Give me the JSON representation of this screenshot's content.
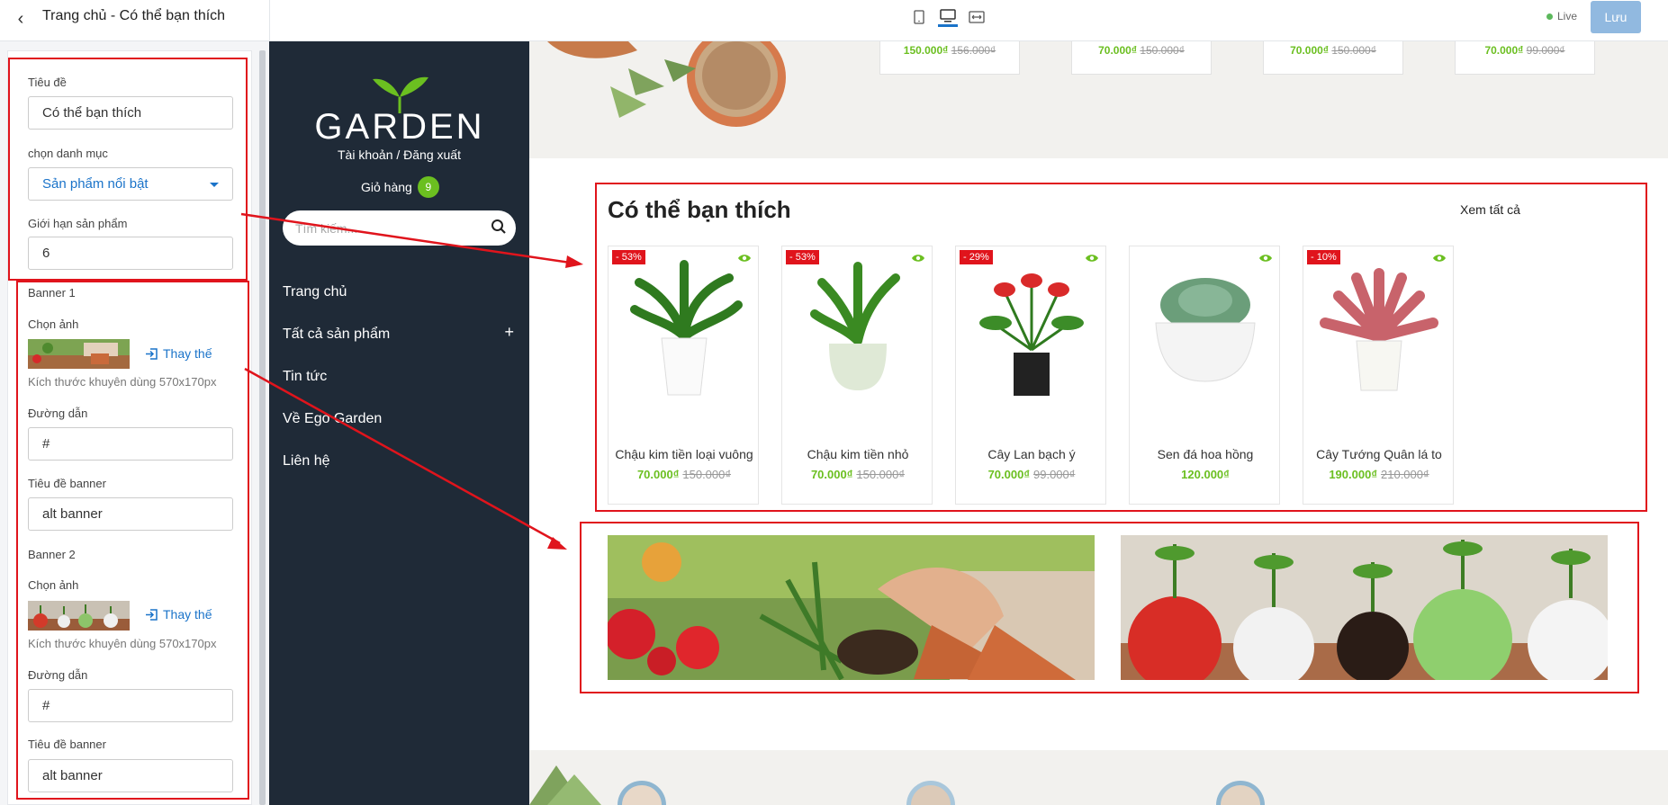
{
  "topbar": {
    "title": "Trang chủ - Có thể bạn thích",
    "live": "Live",
    "save": "Lưu"
  },
  "sidebar": {
    "title_label": "Tiêu đề",
    "title_value": "Có thể bạn thích",
    "category_label": "chọn danh mục",
    "category_value": "Sản phẩm nổi bật",
    "limit_label": "Giới hạn sản phẩm",
    "limit_value": "6",
    "banners": [
      {
        "heading": "Banner 1",
        "image_label": "Chọn ảnh",
        "replace": "Thay thế",
        "hint": "Kích thước khuyên dùng 570x170px",
        "link_label": "Đường dẫn",
        "link_value": "#",
        "alt_label": "Tiêu đề banner",
        "alt_value": "alt banner"
      },
      {
        "heading": "Banner 2",
        "image_label": "Chọn ảnh",
        "replace": "Thay thế",
        "hint": "Kích thước khuyên dùng 570x170px",
        "link_label": "Đường dẫn",
        "link_value": "#",
        "alt_label": "Tiêu đề banner",
        "alt_value": "alt banner"
      }
    ]
  },
  "store": {
    "logo": "GARDEN",
    "account": "Tài khoản / Đăng xuất",
    "cart_label": "Giỏ hàng",
    "cart_count": "9",
    "search_placeholder": "Tìm kiếm...",
    "menu": [
      "Trang chủ",
      "Tất cả sản phẩm",
      "Tin tức",
      "Về Ego Garden",
      "Liên hệ"
    ]
  },
  "previous_prices": [
    {
      "new": "150.000₫",
      "old": "156.000₫"
    },
    {
      "new": "70.000₫",
      "old": "150.000₫"
    },
    {
      "new": "70.000₫",
      "old": "150.000₫"
    },
    {
      "new": "70.000₫",
      "old": "99.000₫"
    }
  ],
  "section": {
    "title": "Có thể bạn thích",
    "see_all": "Xem tất cả",
    "products": [
      {
        "name": "Chậu kim tiền loại vuông",
        "price": "70.000₫",
        "old_price": "150.000₫",
        "badge": "- 53%"
      },
      {
        "name": "Chậu kim tiền nhỏ",
        "price": "70.000₫",
        "old_price": "150.000₫",
        "badge": "- 53%"
      },
      {
        "name": "Cây Lan bạch ý",
        "price": "70.000₫",
        "old_price": "99.000₫",
        "badge": "- 29%"
      },
      {
        "name": "Sen đá hoa hồng",
        "price": "120.000₫",
        "old_price": "",
        "badge": ""
      },
      {
        "name": "Cây Tướng Quân lá to",
        "price": "190.000₫",
        "old_price": "210.000₫",
        "badge": "- 10%"
      }
    ]
  },
  "colors": {
    "accent": "#1a73c9",
    "sale": "#6bbf20",
    "highlight": "#e0141c",
    "nav_bg": "#1f2a37"
  }
}
